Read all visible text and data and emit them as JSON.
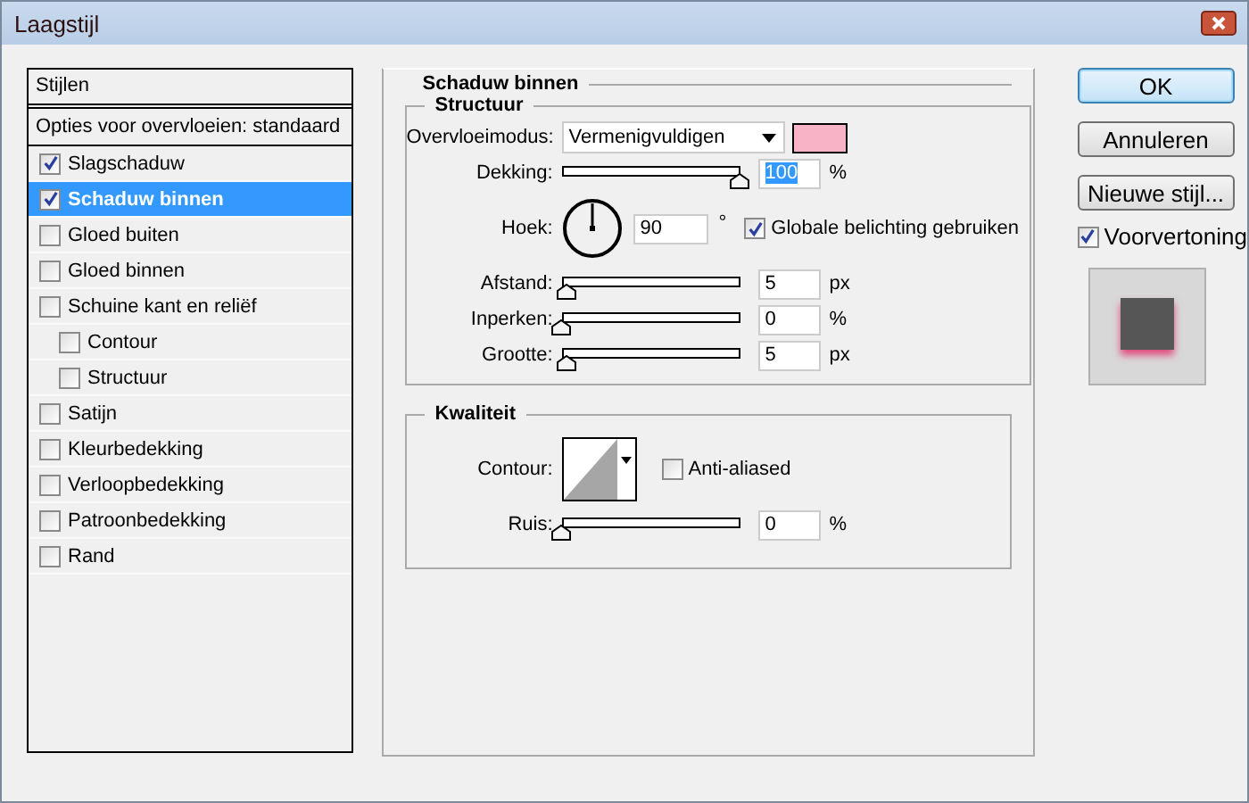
{
  "window": {
    "title": "Laagstijl"
  },
  "styles": {
    "header": "Stijlen",
    "blend_options": "Opties voor overvloeien: standaard",
    "items": [
      {
        "label": "Slagschaduw",
        "checked": true,
        "selected": false
      },
      {
        "label": "Schaduw binnen",
        "checked": true,
        "selected": true
      },
      {
        "label": "Gloed buiten",
        "checked": false,
        "selected": false
      },
      {
        "label": "Gloed binnen",
        "checked": false,
        "selected": false
      },
      {
        "label": "Schuine kant en reliëf",
        "checked": false,
        "selected": false,
        "children": [
          {
            "label": "Contour",
            "checked": false,
            "selected": false
          },
          {
            "label": "Structuur",
            "checked": false,
            "selected": false
          }
        ]
      },
      {
        "label": "Satijn",
        "checked": false,
        "selected": false
      },
      {
        "label": "Kleurbedekking",
        "checked": false,
        "selected": false
      },
      {
        "label": "Verloopbedekking",
        "checked": false,
        "selected": false
      },
      {
        "label": "Patroonbedekking",
        "checked": false,
        "selected": false
      },
      {
        "label": "Rand",
        "checked": false,
        "selected": false
      }
    ]
  },
  "panel": {
    "title": "Schaduw binnen",
    "structure": {
      "title": "Structuur",
      "blend_mode": {
        "label": "Overvloeimodus:",
        "value": "Vermenigvuldigen",
        "color": "#f8b4c6"
      },
      "rows": [
        {
          "kind": "slider",
          "label": "Dekking:",
          "level": 1,
          "value": "100",
          "unit": "%",
          "selected": true
        },
        {
          "kind": "angle",
          "label": "Hoek:",
          "value": "90",
          "unit": "°",
          "checkbox": {
            "label": "Globale belichting gebruiken",
            "checked": true
          }
        },
        {
          "kind": "slider",
          "label": "Afstand:",
          "level": 0.03,
          "value": "5",
          "unit": "px",
          "selected": false
        },
        {
          "kind": "slider",
          "label": "Inperken:",
          "level": 0,
          "value": "0",
          "unit": "%",
          "selected": false
        },
        {
          "kind": "slider",
          "label": "Grootte:",
          "level": 0.03,
          "value": "5",
          "unit": "px",
          "selected": false
        }
      ]
    },
    "quality": {
      "title": "Kwaliteit",
      "contour_label": "Contour:",
      "anti_aliased": {
        "label": "Anti-aliased",
        "checked": false
      },
      "noise": {
        "label": "Ruis:",
        "level": 0,
        "value": "0",
        "unit": "%"
      }
    }
  },
  "buttons": [
    {
      "label": "OK",
      "default": true
    },
    {
      "label": "Annuleren",
      "default": false
    },
    {
      "label": "Nieuwe stijl...",
      "default": false
    }
  ],
  "preview": {
    "label": "Voorvertoning",
    "checked": true
  }
}
